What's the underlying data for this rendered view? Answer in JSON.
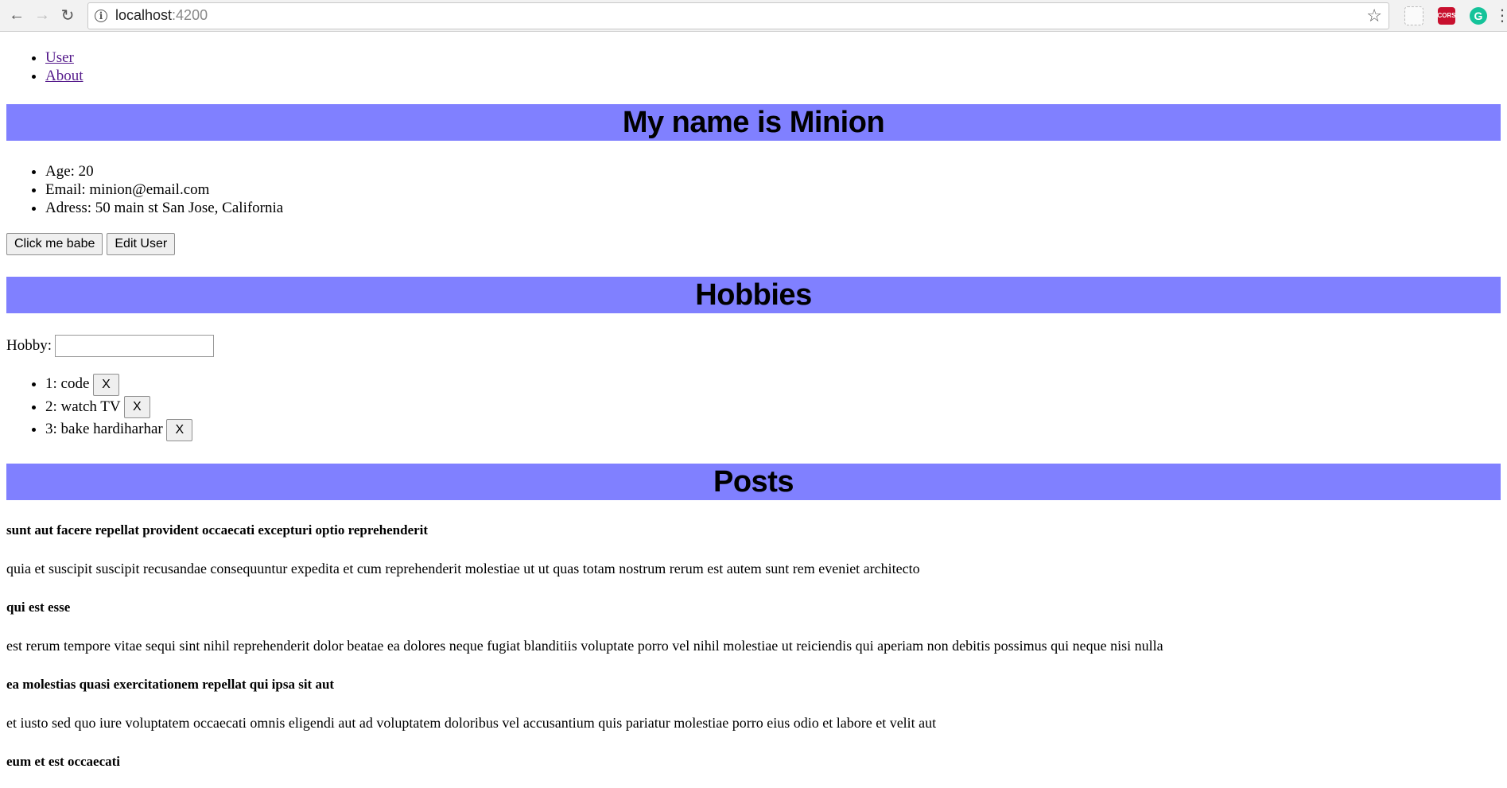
{
  "browser": {
    "url_host": "localhost",
    "url_port": ":4200",
    "info_icon": "info-icon",
    "extensions": [
      {
        "name": "puzzle-extension-icon"
      },
      {
        "name": "cors-extension-icon",
        "label": "CORS"
      },
      {
        "name": "grammarly-extension-icon",
        "label": "G"
      }
    ]
  },
  "nav": {
    "links": [
      "User",
      "About"
    ]
  },
  "user": {
    "heading": "My name is Minion",
    "details": [
      "Age: 20",
      "Email: minion@email.com",
      "Adress: 50 main st San Jose, California"
    ],
    "buttons": {
      "click": "Click me babe",
      "edit": "Edit User"
    }
  },
  "hobbies": {
    "heading": "Hobbies",
    "input_label": "Hobby:",
    "input_value": "",
    "items": [
      "1: code",
      "2: watch TV",
      "3: bake hardiharhar"
    ],
    "remove_label": "X"
  },
  "posts": {
    "heading": "Posts",
    "items": [
      {
        "title": "sunt aut facere repellat provident occaecati excepturi optio reprehenderit",
        "body": "quia et suscipit suscipit recusandae consequuntur expedita et cum reprehenderit molestiae ut ut quas totam nostrum rerum est autem sunt rem eveniet architecto"
      },
      {
        "title": "qui est esse",
        "body": "est rerum tempore vitae sequi sint nihil reprehenderit dolor beatae ea dolores neque fugiat blanditiis voluptate porro vel nihil molestiae ut reiciendis qui aperiam non debitis possimus qui neque nisi nulla"
      },
      {
        "title": "ea molestias quasi exercitationem repellat qui ipsa sit aut",
        "body": "et iusto sed quo iure voluptatem occaecati omnis eligendi aut ad voluptatem doloribus vel accusantium quis pariatur molestiae porro eius odio et labore et velit aut"
      },
      {
        "title": "eum et est occaecati",
        "body": ""
      }
    ]
  },
  "colors": {
    "banner": "#8080ff",
    "link": "#551a8b"
  }
}
